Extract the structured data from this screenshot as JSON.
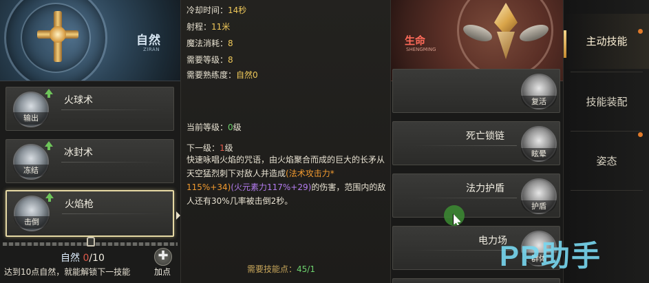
{
  "left_school": {
    "name": "自然",
    "pinyin": "ZIRAN",
    "emblem_icon": "golden-cross-emblem-icon"
  },
  "skills": [
    {
      "name": "火球术",
      "tag": "输出",
      "icon": "fireball-icon",
      "upgradable": true,
      "selected": false
    },
    {
      "name": "冰封术",
      "tag": "冻结",
      "icon": "ice-seal-icon",
      "upgradable": true,
      "selected": false
    },
    {
      "name": "火焰枪",
      "tag": "击倒",
      "icon": "flame-lance-icon",
      "upgradable": true,
      "selected": true
    }
  ],
  "school_progress": {
    "school": "自然",
    "current": "0",
    "max": "/10",
    "unlock_tip": "达到10点自然，就能解锁下一技能",
    "add_point_label": "加点"
  },
  "detail": {
    "cooldown_label": "冷却时间：",
    "cooldown_value": "14秒",
    "range_label": "射程：",
    "range_value": "11米",
    "mana_label": "魔法消耗：",
    "mana_value": "8",
    "level_req_label": "需要等级：",
    "level_req_value": "8",
    "proficiency_label": "需要熟练度：",
    "proficiency_value": "自然0",
    "current_level_label": "当前等级：",
    "current_level_value": "0",
    "current_level_unit": "级",
    "next_level_label": "下一级：",
    "next_level_value": "1",
    "next_level_unit": "级",
    "desc_part1": "快速咏唱火焰的咒语，由火焰聚合而成的巨大的长矛从天空猛烈刺下对敌人并造成",
    "desc_orange1": "(法术攻击力*",
    "desc_orange2": "115%+34)",
    "desc_purple": "(火元素力117%+29)",
    "desc_part2": "的伤害，范围内的敌人还有30%几率被击倒2秒。",
    "need_points_label": "需要技能点：",
    "need_points_value": "45/1"
  },
  "right_school": {
    "name": "生命",
    "pinyin": "SHENGMING",
    "emblem_icon": "winged-gem-emblem-icon"
  },
  "right_skills": [
    {
      "name": "",
      "tag": "复活",
      "icon": "revive-icon"
    },
    {
      "name": "死亡锁链",
      "tag": "眩晕",
      "icon": "death-chain-icon"
    },
    {
      "name": "法力护盾",
      "tag": "护盾",
      "icon": "mana-shield-icon"
    },
    {
      "name": "电力场",
      "tag": "群体",
      "icon": "electric-field-icon"
    }
  ],
  "tabs": [
    {
      "label": "主动技能",
      "active": true,
      "notify": true
    },
    {
      "label": "技能装配",
      "active": false,
      "notify": false
    },
    {
      "label": "姿态",
      "active": false,
      "notify": true
    }
  ],
  "watermark": "PP助手",
  "colors": {
    "value_gold": "#f0c95a",
    "value_green": "#6ed36e",
    "value_red": "#e35a4a",
    "orange_text": "#f19a2f",
    "purple_text": "#b47cf0",
    "life_red": "#ff6b5a",
    "selected_border": "#e6d9a4",
    "watermark": "#78d7f0"
  }
}
